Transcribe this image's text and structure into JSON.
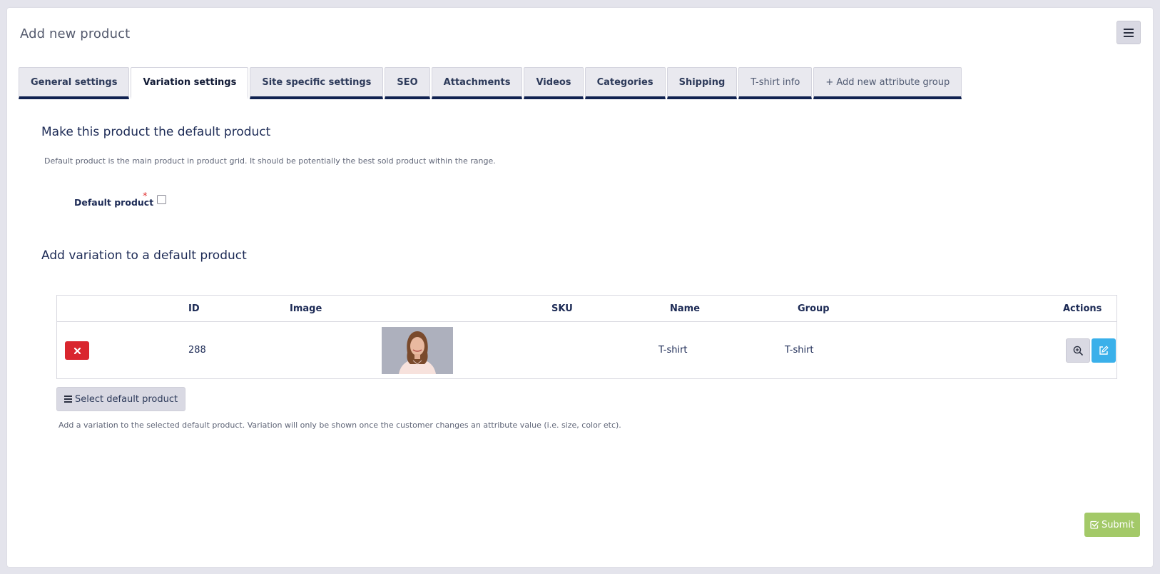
{
  "page": {
    "title": "Add new product",
    "menu_icon": "hamburger-icon"
  },
  "tabs": [
    {
      "label": "General settings",
      "active": false
    },
    {
      "label": "Variation settings",
      "active": true
    },
    {
      "label": "Site specific settings",
      "active": false
    },
    {
      "label": "SEO",
      "active": false
    },
    {
      "label": "Attachments",
      "active": false
    },
    {
      "label": "Videos",
      "active": false
    },
    {
      "label": "Categories",
      "active": false
    },
    {
      "label": "Shipping",
      "active": false
    },
    {
      "label": "T-shirt info",
      "active": false
    },
    {
      "label": "+ Add new attribute group",
      "active": false
    }
  ],
  "default_section": {
    "title": "Make this product the default product",
    "help": "Default product is the main product in product grid. It should be potentially the best sold product within the range.",
    "field_label": "Default product",
    "required_mark": "*",
    "checked": false
  },
  "variation_section": {
    "title": "Add variation to a default product",
    "table": {
      "headers": {
        "id": "ID",
        "image": "Image",
        "sku": "SKU",
        "name": "Name",
        "group": "Group",
        "actions": "Actions"
      },
      "rows": [
        {
          "id": "288",
          "sku": "",
          "name": "T-shirt",
          "group": "T-shirt"
        }
      ]
    },
    "select_button_label": "Select default product",
    "help": "Add a variation to the selected default product. Variation will only be shown once the customer changes an attribute value (i.e. size, color etc)."
  },
  "footer": {
    "submit_label": "Submit"
  },
  "colors": {
    "primary_text": "#1c2a55",
    "tab_underline": "#0f2150",
    "delete": "#d9262e",
    "edit": "#3ab0ea",
    "submit": "#a3c968",
    "required": "#e03030"
  }
}
